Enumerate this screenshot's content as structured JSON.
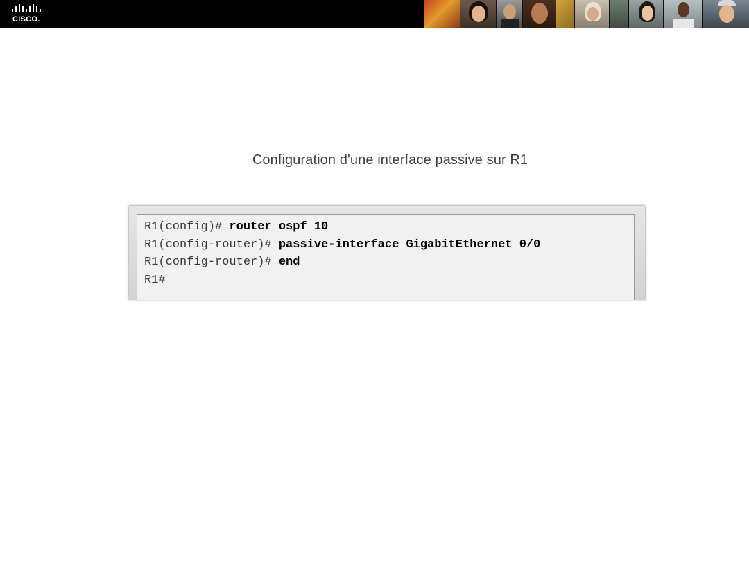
{
  "header": {
    "logo_text": "CISCO.",
    "logo_icon": "cisco-bridge-bars-icon",
    "background_color": "#000000",
    "photo_strip_icon": "people-photo-collage"
  },
  "slide": {
    "title": "Configuration d'une interface passive sur R1",
    "title_color": "#404040"
  },
  "terminal": {
    "lines": [
      {
        "prompt": "R1(config)# ",
        "command": "router ospf 10"
      },
      {
        "prompt": "R1(config-router)# ",
        "command": "passive-interface GigabitEthernet 0/0"
      },
      {
        "prompt": "R1(config-router)# ",
        "command": "end"
      },
      {
        "prompt": "R1#",
        "command": ""
      }
    ]
  }
}
